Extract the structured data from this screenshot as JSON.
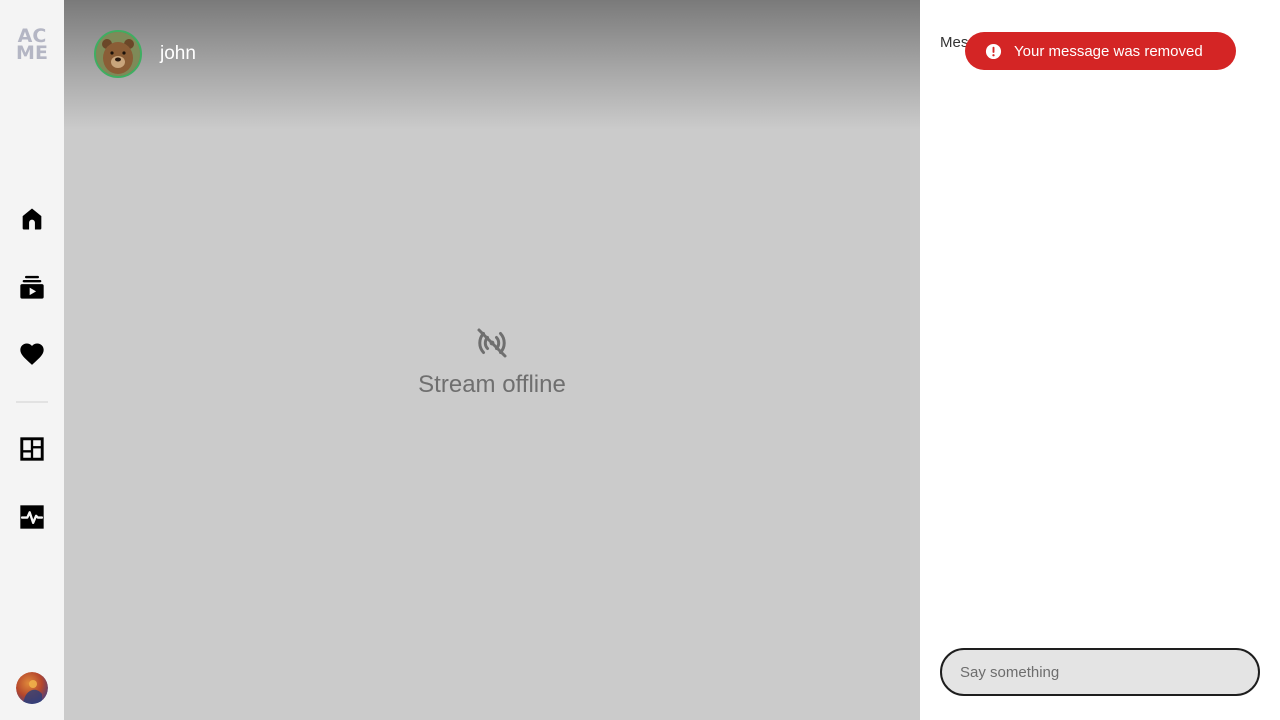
{
  "sidebar": {
    "logo": {
      "line1": "AC",
      "line2": "ME"
    },
    "items": [
      {
        "name": "nav-home",
        "icon": "home-icon"
      },
      {
        "name": "nav-subscriptions",
        "icon": "subscriptions-icon"
      },
      {
        "name": "nav-favorites",
        "icon": "heart-icon"
      },
      {
        "name": "nav-dashboard",
        "icon": "dashboard-icon"
      },
      {
        "name": "nav-activity",
        "icon": "activity-icon"
      }
    ],
    "user_avatar": "user-avatar"
  },
  "stream": {
    "streamer_name": "john",
    "status_text": "Stream offline",
    "status_icon": "signal-offline-icon"
  },
  "chat": {
    "title": "Messages",
    "toast": {
      "text": "Your message was removed",
      "icon": "error-icon",
      "color": "#d42525"
    },
    "input": {
      "placeholder": "Say something",
      "value": ""
    }
  },
  "colors": {
    "sidebar_bg": "#f4f4f4",
    "stream_bg": "#cbcbcb",
    "avatar_ring": "#3fae62",
    "toast_bg": "#d42525"
  }
}
